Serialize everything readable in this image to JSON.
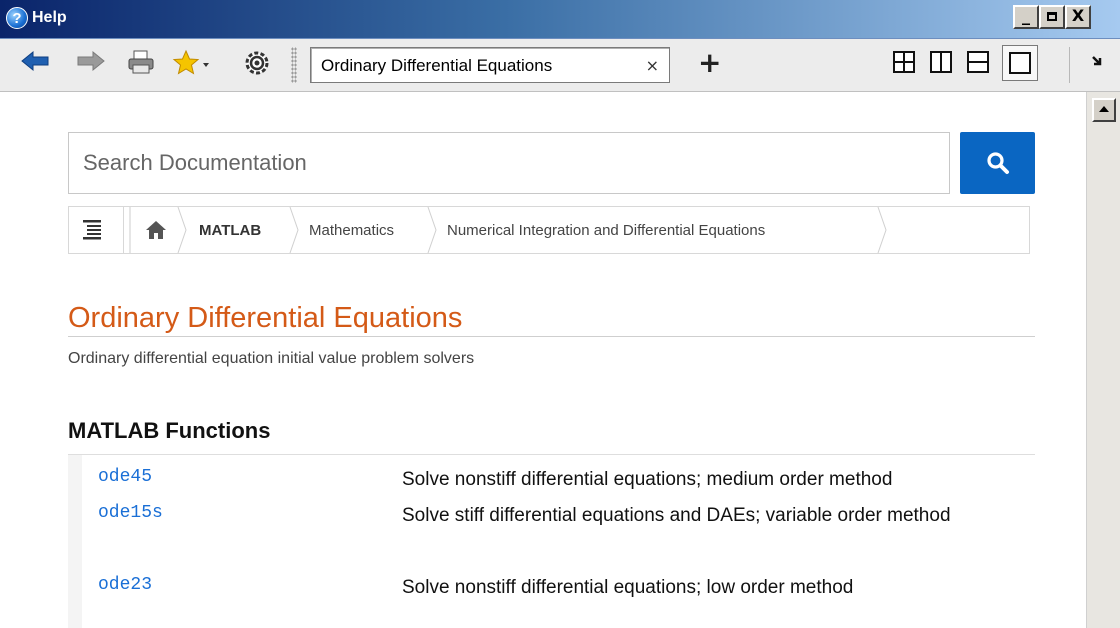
{
  "window": {
    "title": "Help",
    "minimize": "_",
    "maximize": "□",
    "close": "X"
  },
  "toolbar": {
    "tab_title": "Ordinary Differential Equations",
    "tab_close": "×",
    "new_tab": "+",
    "overflow": "»",
    "icons": [
      "back-icon",
      "forward-icon",
      "print-icon",
      "favorites-icon",
      "settings-icon",
      "tile-layout-icon",
      "vertical-split-icon",
      "horizontal-split-icon",
      "single-layout-icon"
    ]
  },
  "search": {
    "placeholder": "Search Documentation"
  },
  "breadcrumb": {
    "items": [
      "MATLAB",
      "Mathematics",
      "Numerical Integration and Differential Equations"
    ]
  },
  "page": {
    "title": "Ordinary Differential Equations",
    "subtitle": "Ordinary differential equation initial value problem solvers",
    "section_heading": "MATLAB Functions"
  },
  "functions": [
    {
      "name": "ode45",
      "description": "Solve nonstiff differential equations; medium order method"
    },
    {
      "name": "ode15s",
      "description": "Solve stiff differential equations and DAEs; variable order method"
    },
    {
      "name": "ode23",
      "description": "Solve nonstiff differential equations; low order method"
    }
  ],
  "colors": {
    "title_orange": "#d45a17",
    "link_blue": "#1a6fd6",
    "search_button": "#0a66c2",
    "titlebar_dark": "#0a246a"
  }
}
